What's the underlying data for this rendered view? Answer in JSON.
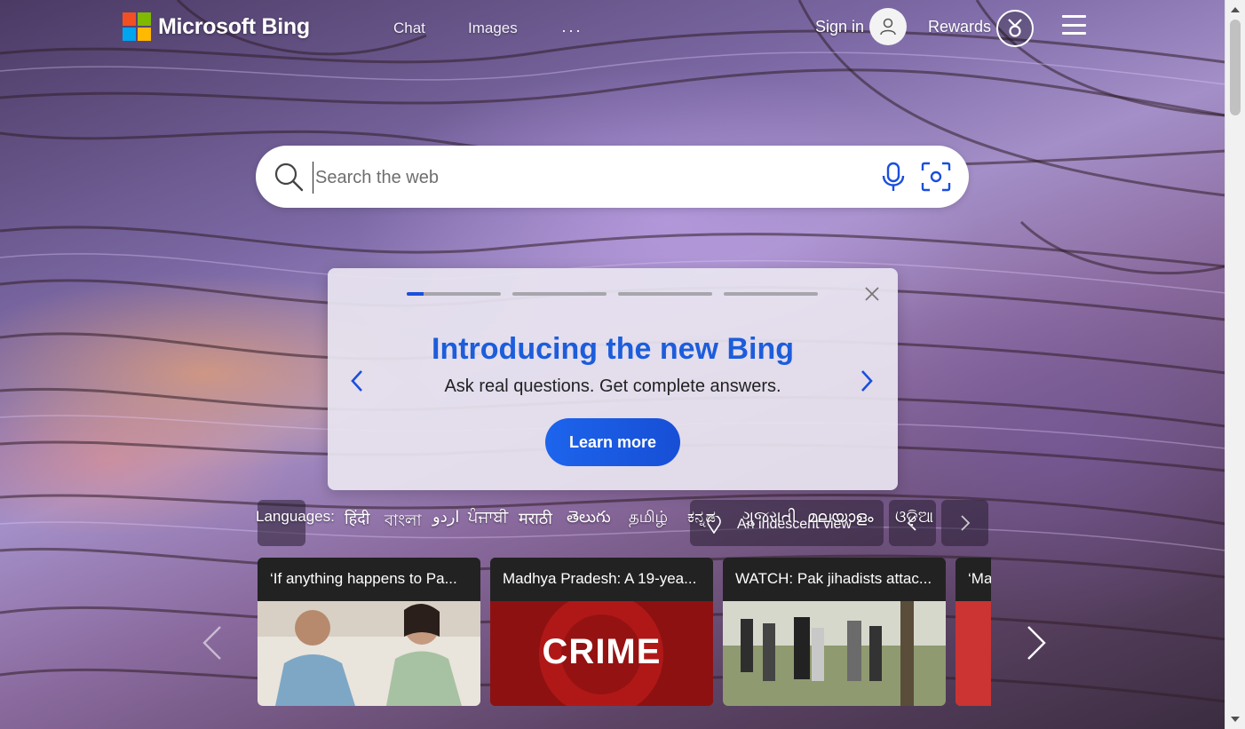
{
  "header": {
    "brand": "Microsoft Bing",
    "nav": [
      {
        "label": "Chat"
      },
      {
        "label": "Images"
      }
    ],
    "more_label": "···",
    "sign_in": "Sign in",
    "rewards": "Rewards"
  },
  "search": {
    "placeholder": "Search the web",
    "value": ""
  },
  "promo": {
    "title": "Introducing the new Bing",
    "subtitle": "Ask real questions. Get complete answers.",
    "button": "Learn more",
    "slide_count": 4,
    "active_slide_progress": 0.18,
    "accent": "#1c5ddb"
  },
  "languages": {
    "label": "Languages:",
    "items": [
      "हिंदी",
      "বাংলা",
      "اردو",
      "ਪੰਜਾਬੀ",
      "मराठी",
      "తెలుగు",
      "தமிழ்",
      "ಕನ್ನಡ",
      "ગુજરાતી",
      "മലയാളം",
      "ଓଡ଼ିଆ"
    ]
  },
  "image_info": {
    "caption": "An iridescent view"
  },
  "news": [
    {
      "headline": "‘If anything happens to Pa..."
    },
    {
      "headline": "Madhya Pradesh: A 19-yea...",
      "image_text": "CRIME"
    },
    {
      "headline": "WATCH: Pak jihadists attac..."
    },
    {
      "headline": "‘Ma"
    }
  ],
  "icons": {
    "search": "search-icon",
    "mic": "microphone-icon",
    "visual_search": "visual-search-icon",
    "close": "close-icon",
    "medal": "rewards-medal-icon"
  }
}
